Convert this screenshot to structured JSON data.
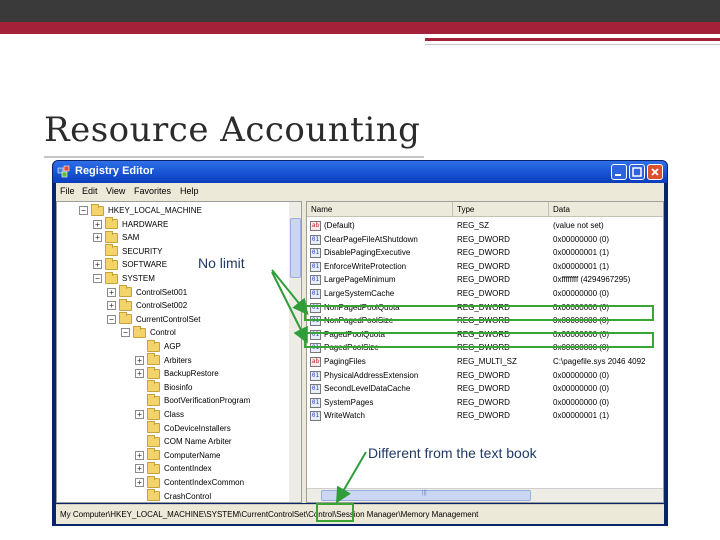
{
  "slide": {
    "title": "Resource Accounting",
    "annotations": {
      "no_limit": "No limit",
      "different": "Different from the text book"
    }
  },
  "window": {
    "title": "Registry Editor",
    "menu": [
      "File",
      "Edit",
      "View",
      "Favorites",
      "Help"
    ],
    "tree": [
      {
        "label": "HKEY_LOCAL_MACHINE",
        "toggle": "-",
        "depth": 0
      },
      {
        "label": "HARDWARE",
        "toggle": "+",
        "depth": 1
      },
      {
        "label": "SAM",
        "toggle": "+",
        "depth": 1
      },
      {
        "label": "SECURITY",
        "toggle": "",
        "depth": 1
      },
      {
        "label": "SOFTWARE",
        "toggle": "+",
        "depth": 1
      },
      {
        "label": "SYSTEM",
        "toggle": "-",
        "depth": 1
      },
      {
        "label": "ControlSet001",
        "toggle": "+",
        "depth": 2
      },
      {
        "label": "ControlSet002",
        "toggle": "+",
        "depth": 2
      },
      {
        "label": "CurrentControlSet",
        "toggle": "-",
        "depth": 2
      },
      {
        "label": "Control",
        "toggle": "-",
        "depth": 3
      },
      {
        "label": "AGP",
        "toggle": "",
        "depth": 4
      },
      {
        "label": "Arbiters",
        "toggle": "+",
        "depth": 4
      },
      {
        "label": "BackupRestore",
        "toggle": "+",
        "depth": 4
      },
      {
        "label": "Biosinfo",
        "toggle": "",
        "depth": 4
      },
      {
        "label": "BootVerificationProgram",
        "toggle": "",
        "depth": 4
      },
      {
        "label": "Class",
        "toggle": "+",
        "depth": 4
      },
      {
        "label": "CoDeviceInstallers",
        "toggle": "",
        "depth": 4
      },
      {
        "label": "COM Name Arbiter",
        "toggle": "",
        "depth": 4
      },
      {
        "label": "ComputerName",
        "toggle": "+",
        "depth": 4
      },
      {
        "label": "ContentIndex",
        "toggle": "+",
        "depth": 4
      },
      {
        "label": "ContentIndexCommon",
        "toggle": "+",
        "depth": 4
      },
      {
        "label": "CrashControl",
        "toggle": "",
        "depth": 4
      }
    ],
    "columns": {
      "name": "Name",
      "type": "Type",
      "data": "Data"
    },
    "values": [
      {
        "name": "(Default)",
        "type": "REG_SZ",
        "data": "(value not set)",
        "icon": "ab"
      },
      {
        "name": "ClearPageFileAtShutdown",
        "type": "REG_DWORD",
        "data": "0x00000000 (0)",
        "icon": "bin"
      },
      {
        "name": "DisablePagingExecutive",
        "type": "REG_DWORD",
        "data": "0x00000001 (1)",
        "icon": "bin"
      },
      {
        "name": "EnforceWriteProtection",
        "type": "REG_DWORD",
        "data": "0x00000001 (1)",
        "icon": "bin"
      },
      {
        "name": "LargePageMinimum",
        "type": "REG_DWORD",
        "data": "0xffffffff (4294967295)",
        "icon": "bin"
      },
      {
        "name": "LargeSystemCache",
        "type": "REG_DWORD",
        "data": "0x00000000 (0)",
        "icon": "bin"
      },
      {
        "name": "NonPagedPoolQuota",
        "type": "REG_DWORD",
        "data": "0x00000000 (0)",
        "icon": "bin"
      },
      {
        "name": "NonPagedPoolSize",
        "type": "REG_DWORD",
        "data": "0x00000000 (0)",
        "icon": "bin"
      },
      {
        "name": "PagedPoolQuota",
        "type": "REG_DWORD",
        "data": "0x00000000 (0)",
        "icon": "bin"
      },
      {
        "name": "PagedPoolSize",
        "type": "REG_DWORD",
        "data": "0x00000000 (0)",
        "icon": "bin"
      },
      {
        "name": "PagingFiles",
        "type": "REG_MULTI_SZ",
        "data": "C:\\pagefile.sys 2046 4092",
        "icon": "ab"
      },
      {
        "name": "PhysicalAddressExtension",
        "type": "REG_DWORD",
        "data": "0x00000000 (0)",
        "icon": "bin"
      },
      {
        "name": "SecondLevelDataCache",
        "type": "REG_DWORD",
        "data": "0x00000000 (0)",
        "icon": "bin"
      },
      {
        "name": "SystemPages",
        "type": "REG_DWORD",
        "data": "0x00000000 (0)",
        "icon": "bin"
      },
      {
        "name": "WriteWatch",
        "type": "REG_DWORD",
        "data": "0x00000001 (1)",
        "icon": "bin"
      }
    ],
    "status": "My Computer\\HKEY_LOCAL_MACHINE\\SYSTEM\\CurrentControlSet\\Control\\Session Manager\\Memory Management"
  },
  "colors": {
    "highlight": "#3aa535",
    "arrow": "#2f9e3a",
    "accent_band": "#a3223a"
  }
}
